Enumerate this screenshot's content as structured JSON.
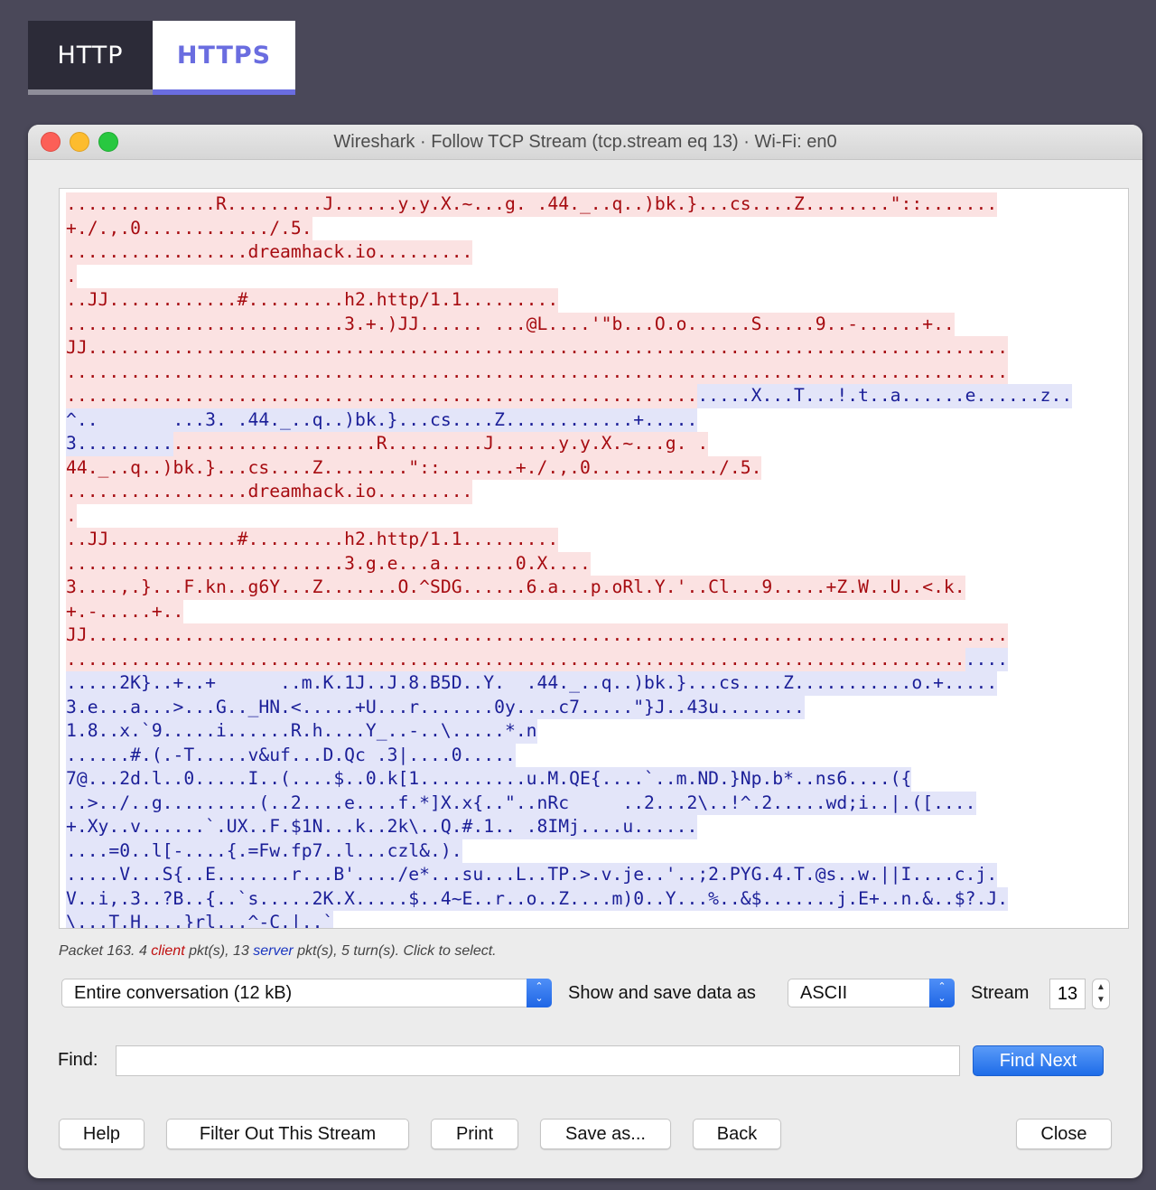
{
  "tabs": [
    {
      "label": "HTTP"
    },
    {
      "label": "HTTPS"
    }
  ],
  "window": {
    "title": "Wireshark · Follow TCP Stream (tcp.stream eq 13) · Wi-Fi: en0"
  },
  "stream_lines": [
    [
      [
        "c",
        "..............R.........J......y.y.X.~...g. .44._..q..)bk.}...cs....Z........\"::......."
      ]
    ],
    [
      [
        "c",
        "+./.,.0............/.5."
      ]
    ],
    [
      [
        "c",
        ".................dreamhack.io........."
      ]
    ],
    [
      [
        "c",
        "."
      ]
    ],
    [
      [
        "c",
        "..JJ............#.........h2.http/1.1........."
      ]
    ],
    [
      [
        "c",
        "..........................3.+.)JJ...... ...@L....'\"b...O.o......S.....9..-......+.."
      ]
    ],
    [
      [
        "c",
        "JJ......................................................................................"
      ]
    ],
    [
      [
        "c",
        "........................................................................................"
      ]
    ],
    [
      [
        "c",
        "..........................................................."
      ],
      [
        "s",
        ".....X...T...!.t..a......e......z.."
      ]
    ],
    [
      [
        "s",
        "^..       ...3. .44._..q..)bk.}...cs....Z............+....."
      ]
    ],
    [
      [
        "s",
        "3........."
      ],
      [
        "c",
        "...................R.........J......y.y.X.~...g. ."
      ]
    ],
    [
      [
        "c",
        "44._..q..)bk.}...cs....Z........\"::.......+./.,.0............/.5."
      ]
    ],
    [
      [
        "c",
        ".................dreamhack.io........."
      ]
    ],
    [
      [
        "c",
        "."
      ]
    ],
    [
      [
        "c",
        "..JJ............#.........h2.http/1.1........."
      ]
    ],
    [
      [
        "c",
        "..........................3.g.e...a.......0.X...."
      ]
    ],
    [
      [
        "c",
        "3....,.}...F.kn..g6Y...Z.......O.^SDG......6.a...p.oRl.Y.'..Cl...9.....+Z.W..U..<.k."
      ]
    ],
    [
      [
        "c",
        "+.-.....+.."
      ]
    ],
    [
      [
        "c",
        "JJ......................................................................................"
      ]
    ],
    [
      [
        "c",
        "...................................................................................."
      ],
      [
        "s",
        "...."
      ]
    ],
    [
      [
        "s",
        ".....2K}..+..+      ..m.K.1J..J.8.B5D..Y.  .44._..q..)bk.}...cs....Z...........o.+....."
      ]
    ],
    [
      [
        "s",
        "3.e...a...>...G.._HN.<.....+U...r.......0y....c7.....\"}J..43u........"
      ]
    ],
    [
      [
        "s",
        "1.8..x.`9.....i......R.h....Y_..-..\\.....*.n"
      ]
    ],
    [
      [
        "s",
        "......#.(.-T.....v&uf...D.Qc .3|....0....."
      ]
    ],
    [
      [
        "s",
        "7@...2d.l..0.....I..(....$..0.k[1..........u.M.QE{....`..m.ND.}Np.b*..ns6....({"
      ]
    ],
    [
      [
        "s",
        "..>../..g.........(..2....e....f.*]X.x{..\"..nRc     ..2...2\\..!^.2.....wd;i..|.([...."
      ]
    ],
    [
      [
        "s",
        "+.Xy..v......`.UX..F.$1N...k..2k\\..Q.#.1.. .8IMj....u......"
      ]
    ],
    [
      [
        "s",
        "....=0..l[-....{.=Fw.fp7..l...czl&.)."
      ]
    ],
    [
      [
        "s",
        ".....V...S{..E.......r...B'..../e*...su...L..TP.>.v.je..'..;2.PYG.4.T.@s..w.||I....c.j."
      ]
    ],
    [
      [
        "s",
        "V..i,.3..?B..{..`s.....2K.X.....$..4~E..r..o..Z....m)0..Y...%..&$.......j.E+..n.&..$?.J."
      ]
    ],
    [
      [
        "s",
        "\\...T.H....}rl...^-C.|..`"
      ]
    ]
  ],
  "status": {
    "prefix": "Packet 163. 4 ",
    "client_word": "client",
    "middle": " pkt(s), 13 ",
    "server_word": "server",
    "suffix": " pkt(s), 5 turn(s). Click to select."
  },
  "controls": {
    "conversation_select": "Entire conversation (12 kB)",
    "show_save_label": "Show and save data as",
    "format_select": "ASCII",
    "stream_label": "Stream",
    "stream_value": "13",
    "find_label": "Find:",
    "find_value": "",
    "find_next": "Find Next"
  },
  "buttons": {
    "help": "Help",
    "filter_out": "Filter Out This Stream",
    "print": "Print",
    "save_as": "Save as...",
    "back": "Back",
    "close": "Close"
  },
  "colors": {
    "client_text": "#a60b10",
    "client_bg": "#fbe2e2",
    "server_text": "#1b1f98",
    "server_bg": "#e3e5f9",
    "accent": "#1e6ce8",
    "https_tab": "#6a6de0"
  },
  "icons": {
    "stepper": "up-down-chevron-icon"
  }
}
